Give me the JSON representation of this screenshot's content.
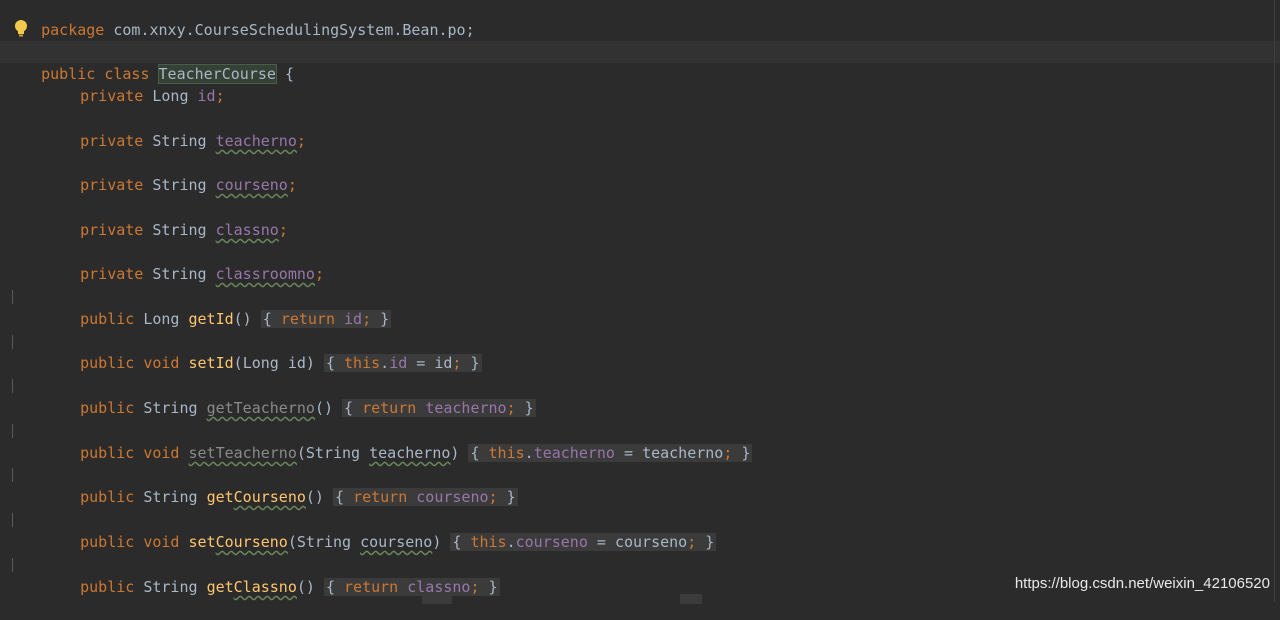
{
  "editor": {
    "package_kw": "package",
    "package_name": " com.xnxy.CourseSchedulingSystem.Bean.po;",
    "public_kw": "public",
    "class_kw": "class",
    "class_name": "TeacherCourse",
    "open_brace": " {",
    "fields": [
      {
        "mod": "private",
        "type": "Long",
        "name": "id"
      },
      {
        "mod": "private",
        "type": "String",
        "name": "teacherno"
      },
      {
        "mod": "private",
        "type": "String",
        "name": "courseno"
      },
      {
        "mod": "private",
        "type": "String",
        "name": "classno"
      },
      {
        "mod": "private",
        "type": "String",
        "name": "classroomno"
      }
    ],
    "methods": {
      "getId": {
        "mod": "public",
        "ret": "Long",
        "name": "getId",
        "params": "()",
        "open": "{",
        "ret_kw": "return",
        "val": "id",
        "semi": ";",
        "close": "}"
      },
      "setId": {
        "mod": "public",
        "ret": "void",
        "name": "setId",
        "params_open": "(",
        "ptype": "Long",
        "pname": "id",
        "params_close": ")",
        "open": "{",
        "this": "this",
        "field": "id",
        "eq": " = ",
        "val": "id",
        "semi": ";",
        "close": "}"
      },
      "getTeacherno": {
        "mod": "public",
        "ret": "String",
        "name": "getTeacherno",
        "params": "()",
        "open": "{",
        "ret_kw": "return",
        "val": "teacherno",
        "semi": ";",
        "close": "}"
      },
      "setTeacherno": {
        "mod": "public",
        "ret": "void",
        "name": "setTeacherno",
        "params_open": "(",
        "ptype": "String",
        "pname": "teacherno",
        "params_close": ")",
        "open": "{",
        "this": "this",
        "field": "teacherno",
        "eq": " = ",
        "val": "teacherno",
        "semi": ";",
        "close": "}"
      },
      "getCourseno": {
        "mod": "public",
        "ret": "String",
        "name_pre": "get",
        "name_ul": "Courseno",
        "params": "()",
        "open": "{",
        "ret_kw": "return",
        "val": "courseno",
        "semi": ";",
        "close": "}"
      },
      "setCourseno": {
        "mod": "public",
        "ret": "void",
        "name_pre": "set",
        "name_ul": "Courseno",
        "params_open": "(",
        "ptype": "String",
        "pname": "courseno",
        "params_close": ")",
        "open": "{",
        "this": "this",
        "field": "courseno",
        "eq": " = ",
        "val": "courseno",
        "semi": ";",
        "close": "}"
      },
      "getClassno": {
        "mod": "public",
        "ret": "String",
        "name_pre": "get",
        "name_ul": "Classno",
        "params": "()",
        "open": "{",
        "ret_kw": "return",
        "val": "classno",
        "semi": ";",
        "close": "}"
      }
    }
  },
  "watermark": "https://blog.csdn.net/weixin_42106520",
  "icons": {
    "bulb": "lightbulb-icon"
  }
}
